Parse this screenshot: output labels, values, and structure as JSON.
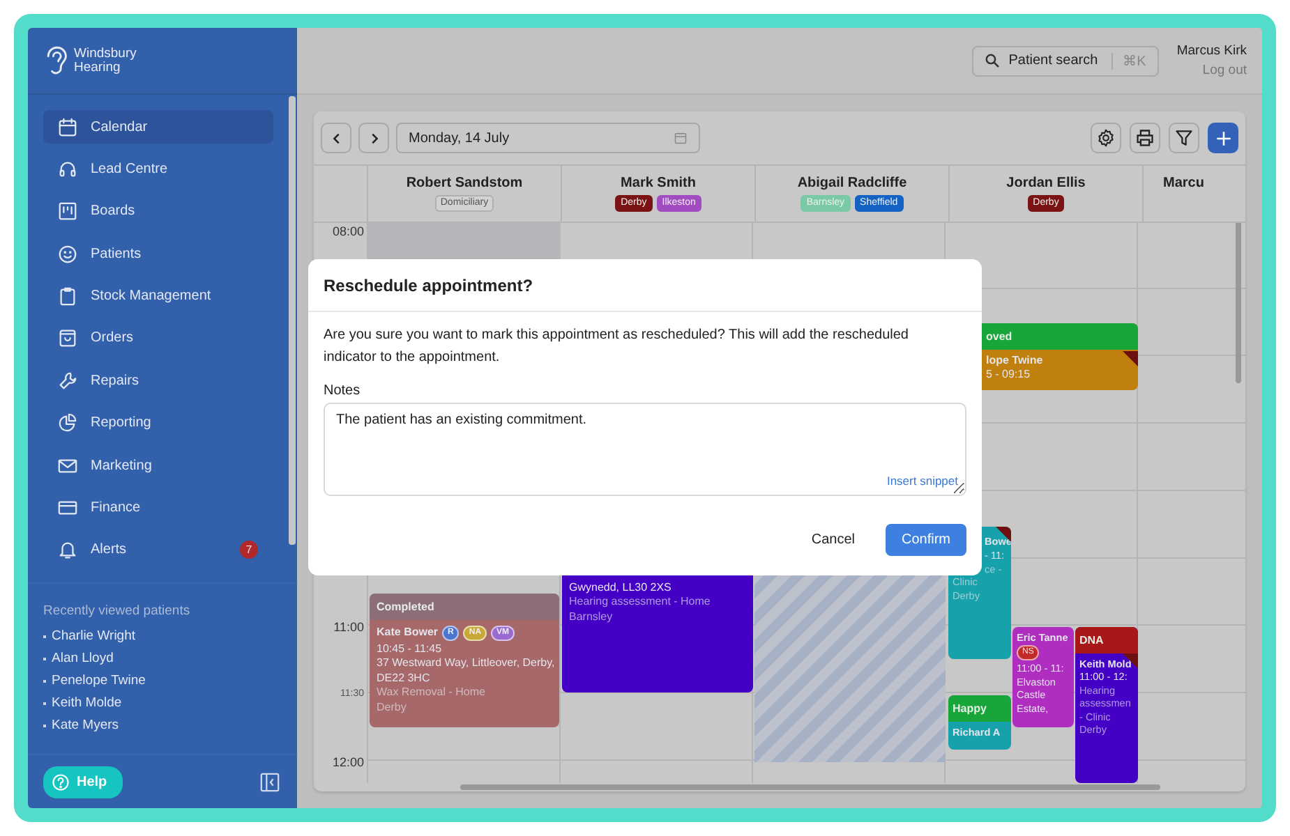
{
  "brand": {
    "name": "Windsbury Hearing"
  },
  "sidebar": {
    "items": [
      {
        "label": "Calendar",
        "selected": true
      },
      {
        "label": "Lead Centre",
        "selected": false
      },
      {
        "label": "Boards",
        "selected": false
      },
      {
        "label": "Patients",
        "selected": false
      },
      {
        "label": "Stock Management",
        "selected": false
      },
      {
        "label": "Orders",
        "selected": false
      },
      {
        "label": "Repairs",
        "selected": false
      },
      {
        "label": "Reporting",
        "selected": false
      },
      {
        "label": "Marketing",
        "selected": false
      },
      {
        "label": "Finance",
        "selected": false
      },
      {
        "label": "Alerts",
        "selected": false,
        "badge": "7"
      }
    ],
    "recent": {
      "heading": "Recently viewed patients",
      "patients": [
        "Charlie Wright",
        "Alan Lloyd",
        "Penelope Twine",
        "Keith Molde",
        "Kate Myers"
      ]
    },
    "help_button": "Help"
  },
  "topbar": {
    "search": {
      "label": "Patient search",
      "shortcut": "⌘K"
    },
    "user": {
      "name": "Marcus Kirk",
      "logout": "Log out"
    }
  },
  "calendar": {
    "date": "Monday, 14 July",
    "columns": [
      {
        "name": "Robert Sandstom",
        "tags": [
          {
            "label": "Domiciliary",
            "kind": "outline",
            "color": "#d2d2d2"
          }
        ]
      },
      {
        "name": "Mark Smith",
        "tags": [
          {
            "label": "Derby",
            "kind": "filled",
            "color": "#7a1414"
          },
          {
            "label": "Ilkeston",
            "kind": "filled",
            "color": "#a24cc2"
          }
        ]
      },
      {
        "name": "Abigail Radcliffe",
        "tags": [
          {
            "label": "Barnsley",
            "kind": "filled",
            "color": "#78c9a4"
          },
          {
            "label": "Sheffield",
            "kind": "filled",
            "color": "#1462c4"
          }
        ]
      },
      {
        "name": "Jordan Ellis",
        "tags": [
          {
            "label": "Derby",
            "kind": "filled",
            "color": "#7a1414"
          }
        ]
      },
      {
        "name": "Marcu"
      }
    ],
    "times": [
      {
        "label": "08:00",
        "kind": "hour"
      },
      {
        "label": "11:00",
        "kind": "hour"
      },
      {
        "label": "11:30",
        "kind": "half"
      },
      {
        "label": "12:00",
        "kind": "hour"
      }
    ],
    "events": [
      {
        "color": "#bf800e",
        "flagged": true,
        "header": {
          "label": "oved",
          "color": "#18a63a"
        },
        "lines": [
          {
            "text": "lope Twine",
            "kind": "name"
          },
          {
            "text": "5 - 09:15",
            "kind": "time"
          }
        ]
      },
      {
        "color": "#16a1ab",
        "flagged": true,
        "lines": [
          {
            "text": "Bowe",
            "kind": "name"
          },
          {
            "text": "- 11:",
            "kind": "time"
          },
          {
            "text": "ce -",
            "kind": "muted"
          },
          {
            "text": "Clinic",
            "kind": "muted"
          },
          {
            "text": "Derby",
            "kind": "muted"
          }
        ]
      },
      {
        "color": "#4400c4",
        "flagged": false,
        "lines": [
          {
            "text": "Gwynedd, LL30 2XS",
            "kind": "detail"
          },
          {
            "text": "Hearing assessment - Home",
            "kind": "muted"
          },
          {
            "text": "Barnsley",
            "kind": "muted"
          }
        ]
      },
      {
        "color": "#a66868",
        "flagged": false,
        "header": {
          "label": "Completed",
          "color": "#8c6e78"
        },
        "lines": [
          {
            "text": "Kate Bower",
            "kind": "name",
            "badges": [
              {
                "label": "R",
                "color": "#4a76d0"
              },
              {
                "label": "NA",
                "color": "#c9a838"
              },
              {
                "label": "VM",
                "color": "#9a6ad0"
              }
            ]
          },
          {
            "text": "10:45 - 11:45",
            "kind": "time"
          },
          {
            "text": "37 Westward Way, Littleover, Derby, DE22 3HC",
            "kind": "detail"
          },
          {
            "text": "Wax Removal - Home",
            "kind": "muted"
          },
          {
            "text": "Derby",
            "kind": "muted"
          }
        ]
      },
      {
        "color": "#16a1ab",
        "flagged": false,
        "header": {
          "label": "Happy",
          "color": "#18a63a"
        },
        "lines": [
          {
            "text": "Richard A",
            "kind": "name"
          }
        ]
      },
      {
        "color": "#b02ebf",
        "flagged": false,
        "lines": [
          {
            "text": "Eric Tanne",
            "kind": "name"
          },
          {
            "kind": "badges",
            "badges": [
              {
                "label": "NS",
                "color": "#c42a2a"
              }
            ]
          },
          {
            "text": "11:00 - 11:",
            "kind": "time"
          },
          {
            "text": "Elvaston",
            "kind": "detail"
          },
          {
            "text": "Castle",
            "kind": "detail"
          },
          {
            "text": "Estate,",
            "kind": "detail"
          }
        ]
      },
      {
        "color": "#4400c4",
        "flagged": true,
        "header": {
          "label": "DNA",
          "color": "#a81818"
        },
        "lines": [
          {
            "text": "Keith Mold",
            "kind": "name"
          },
          {
            "text": "11:00 - 12:",
            "kind": "time"
          },
          {
            "text": "Hearing",
            "kind": "muted"
          },
          {
            "text": "assessmen",
            "kind": "muted"
          },
          {
            "text": "- Clinic",
            "kind": "muted"
          },
          {
            "text": "Derby",
            "kind": "muted"
          }
        ]
      }
    ]
  },
  "modal": {
    "title": "Reschedule appointment?",
    "message": "Are you sure you want to mark this appointment as rescheduled? This will add the rescheduled indicator to the appointment.",
    "notes_label": "Notes",
    "notes_value": "The patient has an existing commitment.",
    "snippet_link": "Insert snippet",
    "buttons": [
      {
        "label": "Cancel",
        "kind": "secondary"
      },
      {
        "label": "Confirm",
        "kind": "primary"
      }
    ]
  }
}
